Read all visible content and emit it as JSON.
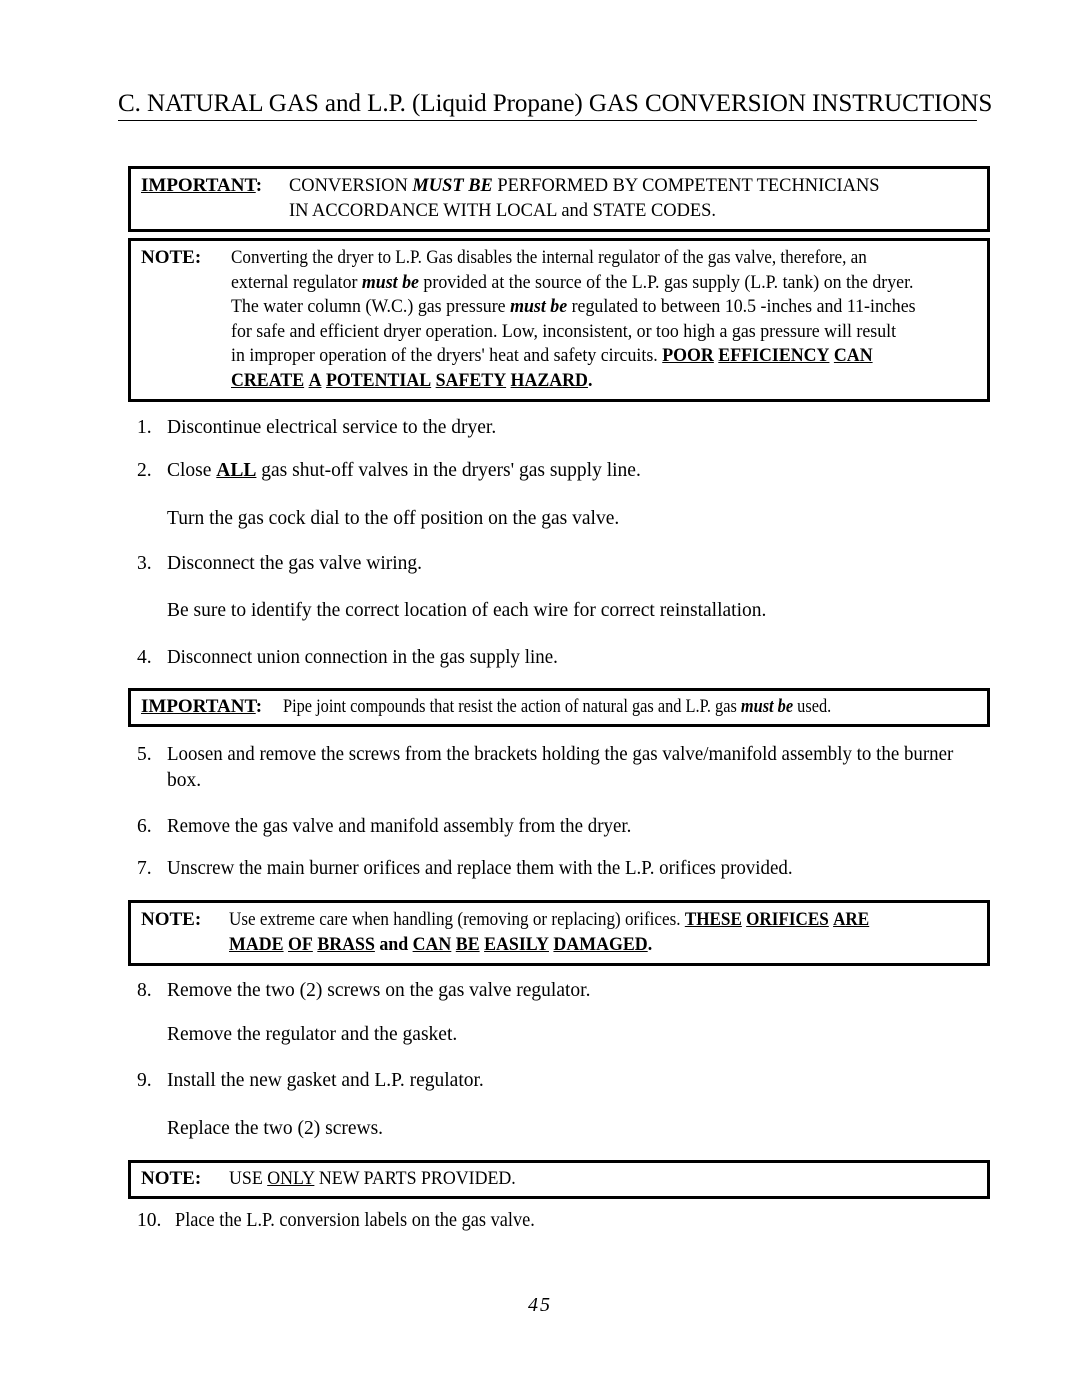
{
  "document": {
    "title": "C.  NATURAL GAS and L.P. (Liquid Propane) GAS CONVERSION INSTRUCTIONS",
    "page_number": "45"
  },
  "callout_important_1": {
    "tag": "IMPORTANT",
    "tag_colon": ":",
    "line1_a": "CONVERSION ",
    "line1_b": "MUST BE",
    "line1_c": " PERFORMED BY COMPETENT TECHNICIANS",
    "line2": "IN ACCORDANCE WITH LOCAL and STATE CODES."
  },
  "callout_note_1": {
    "tag": "NOTE",
    "tag_colon": ":",
    "line1": "Converting the dryer to L.P. Gas disables the internal regulator of the gas valve, therefore, an",
    "line2_a": "external regulator  ",
    "line2_b": "must be",
    "line2_c": " provided at the source of the L.P. gas supply (L.P. tank) on the dryer.",
    "line3_a": "The water column (W.C.) gas pressure ",
    "line3_b": "must be",
    "line3_c": " regulated to between 10.5 -inches and 11-inches",
    "line4": "for safe and efficient dryer operation.  Low, inconsistent, or too high a gas pressure will result",
    "line5_a": "in improper operation of the dryers'  heat and safety circuits.  ",
    "line5_b": "POOR",
    "line5_c": "EFFICIENCY",
    "line5_d": "CAN",
    "line6_a": "CREATE",
    "line6_b": "A",
    "line6_c": "POTENTIAL",
    "line6_d": "SAFETY",
    "line6_e": "HAZARD",
    "line6_f": "."
  },
  "callout_important_2": {
    "tag": "IMPORTANT",
    "tag_colon": ":",
    "line1_a": "Pipe joint compounds that resist the action of natural gas and L.P. gas ",
    "line1_b": "must be",
    "line1_c": " used."
  },
  "callout_note_2": {
    "tag": "NOTE",
    "tag_colon": ":",
    "line1_a": "Use extreme care when handling (removing or replacing) orifices.  ",
    "line1_b": "THESE",
    "line1_c": "ORIFICES",
    "line1_d": "ARE",
    "line2_a": "MADE",
    "line2_b": "OF",
    "line2_c": "BRASS",
    "line2_d": "and",
    "line2_e": "CAN",
    "line2_f": "BE",
    "line2_g": "EASILY",
    "line2_h": "DAMAGED",
    "line2_i": "."
  },
  "callout_note_3": {
    "tag": "NOTE",
    "tag_colon": ":",
    "line1_a": "USE ",
    "line1_b": "ONLY",
    "line1_c": " NEW PARTS PROVIDED."
  },
  "steps": [
    {
      "num": "1.",
      "text": "Discontinue electrical service to the dryer."
    },
    {
      "num": "2.",
      "text_a": "Close ",
      "text_b": "ALL",
      "text_c": " gas shut-off valves in the dryers' gas supply line."
    },
    {
      "num": "3.",
      "text": "Disconnect the gas valve wiring."
    },
    {
      "num": "4.",
      "text": "Disconnect union connection in the gas supply line."
    },
    {
      "num": "5.",
      "text": "Loosen and remove the screws from the brackets holding the gas valve/manifold assembly to the burner",
      "text_line2": "box."
    },
    {
      "num": "6.",
      "text": "Remove the gas valve and manifold assembly from the dryer."
    },
    {
      "num": "7.",
      "text": "Unscrew the main burner orifices and replace them with the L.P. orifices provided."
    },
    {
      "num": "8.",
      "text": "Remove the two (2) screws on the gas valve regulator."
    },
    {
      "num": "9.",
      "text": "Install the new gasket and L.P. regulator."
    },
    {
      "num": "10.",
      "text": "Place the L.P. conversion labels on the gas valve."
    }
  ],
  "subparagraphs": {
    "after_step2": "Turn the gas cock dial to the off position on the gas valve.",
    "after_step3": "Be sure to identify the correct location of each wire for correct reinstallation.",
    "after_step8": "Remove the regulator and the gasket.",
    "after_step9": "Replace the two (2) screws."
  }
}
